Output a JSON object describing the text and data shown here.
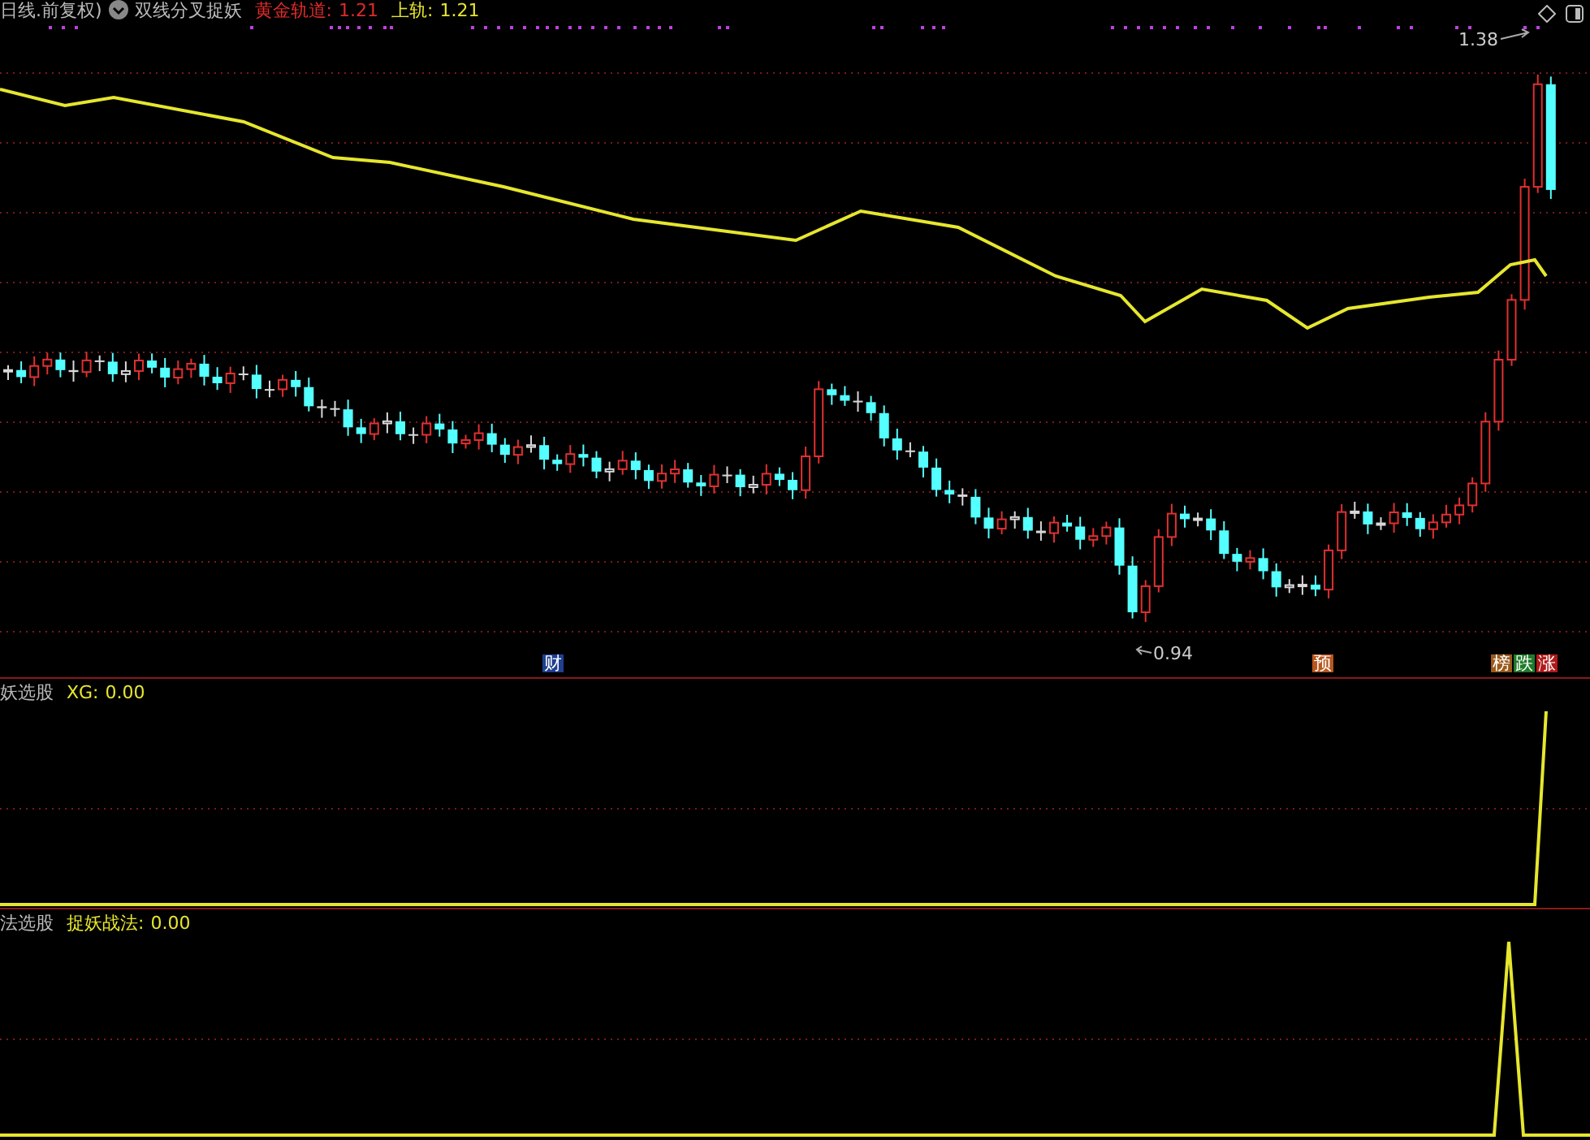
{
  "header": {
    "period": "日线.前复权)",
    "indicator": "双线分叉捉妖",
    "legend": [
      {
        "name": "黄金轨道:",
        "value": "1.21",
        "color": "#e02a2a"
      },
      {
        "name": "上轨:",
        "value": "1.21",
        "color": "#e6e62e"
      }
    ]
  },
  "price_labels": {
    "high": "1.38",
    "low": "0.94"
  },
  "markers": [
    {
      "label": "财",
      "color": "#1f3f8f"
    },
    {
      "label": "预",
      "color": "#b8561c"
    },
    {
      "label": "榜",
      "color": "#9a5a1c"
    },
    {
      "label": "跌",
      "color": "#1f7a2a"
    },
    {
      "label": "涨",
      "color": "#b01a1a"
    }
  ],
  "panels": [
    {
      "name": "妖选股",
      "legend": [
        {
          "name": "XG:",
          "value": "0.00"
        }
      ]
    },
    {
      "name": "法选股",
      "legend": [
        {
          "name": "捉妖战法:",
          "value": "0.00"
        }
      ]
    }
  ]
}
